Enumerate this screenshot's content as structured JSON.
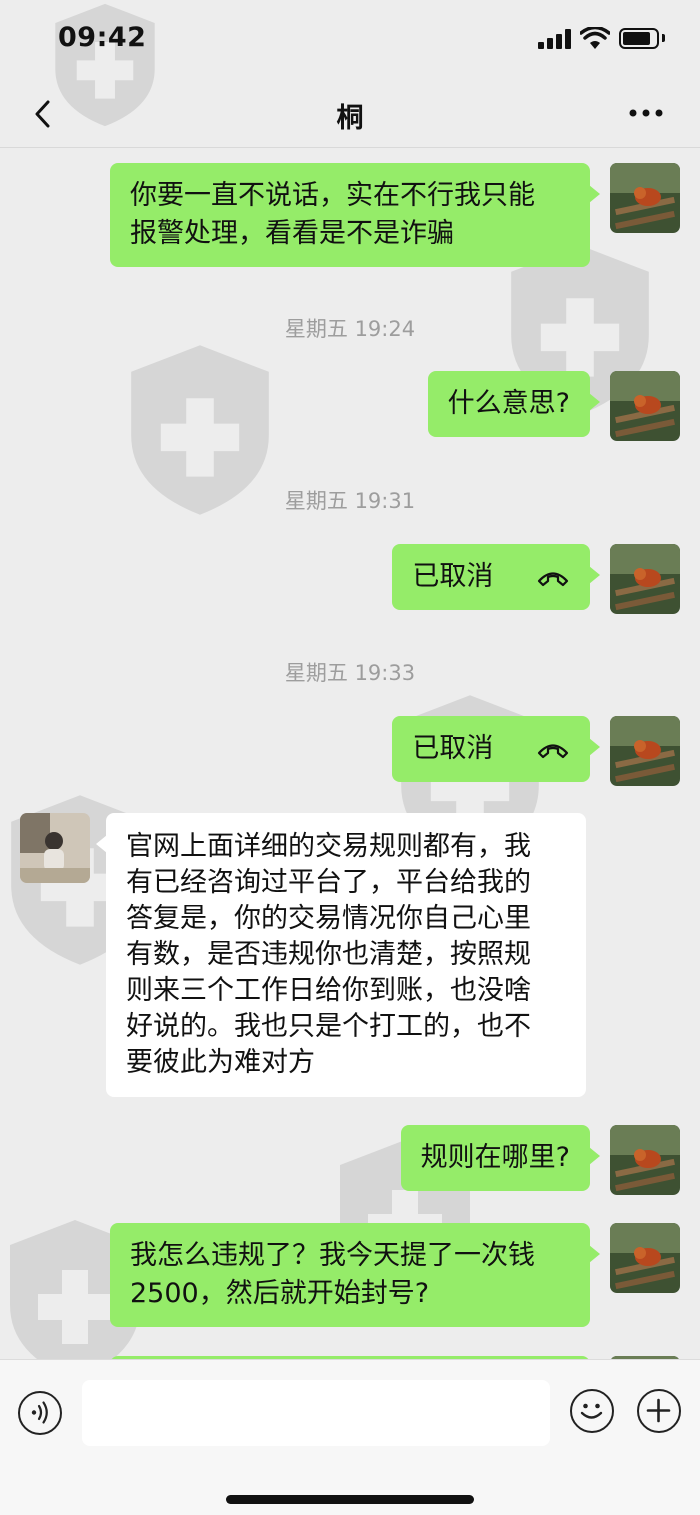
{
  "status_bar": {
    "time": "09:42",
    "battery_level": 0.85
  },
  "nav": {
    "title": "桐",
    "back_icon": "chevron-left-icon",
    "more_icon": "ellipsis-icon"
  },
  "messages": [
    {
      "from": "me",
      "text_line1": "你要一直不说话，实在不行我只能",
      "text_line2": "报警处理，看看是不是诈骗"
    },
    {
      "type": "timestamp",
      "text": "星期五 19:24"
    },
    {
      "from": "me",
      "text": "什么意思?"
    },
    {
      "type": "timestamp",
      "text": "星期五 19:31"
    },
    {
      "from": "me",
      "type": "call",
      "text": "已取消",
      "icon": "phone-hangup-icon"
    },
    {
      "type": "timestamp",
      "text": "星期五 19:33"
    },
    {
      "from": "me",
      "type": "call",
      "text": "已取消",
      "icon": "phone-hangup-icon"
    },
    {
      "from": "them",
      "lines": [
        "官网上面详细的交易规则都有，我",
        "有已经咨询过平台了，平台给我的",
        "答复是，你的交易情况你自己心里",
        "有数，是否违规你也清楚，按照规",
        "则来三个工作日给你到账，也没啥",
        "好说的。我也只是个打工的，也不",
        "要彼此为难对方"
      ]
    },
    {
      "from": "me",
      "text": "规则在哪里?"
    },
    {
      "from": "me",
      "text_line1": "我怎么违规了？我今天提了一次钱",
      "text_line2": "2500，然后就开始封号?"
    }
  ],
  "input_bar": {
    "voice_icon": "voice-icon",
    "emoji_icon": "emoji-icon",
    "plus_icon": "plus-icon",
    "placeholder": ""
  },
  "colors": {
    "my_bubble": "#95ec69",
    "their_bubble": "#ffffff",
    "background": "#ededed"
  }
}
